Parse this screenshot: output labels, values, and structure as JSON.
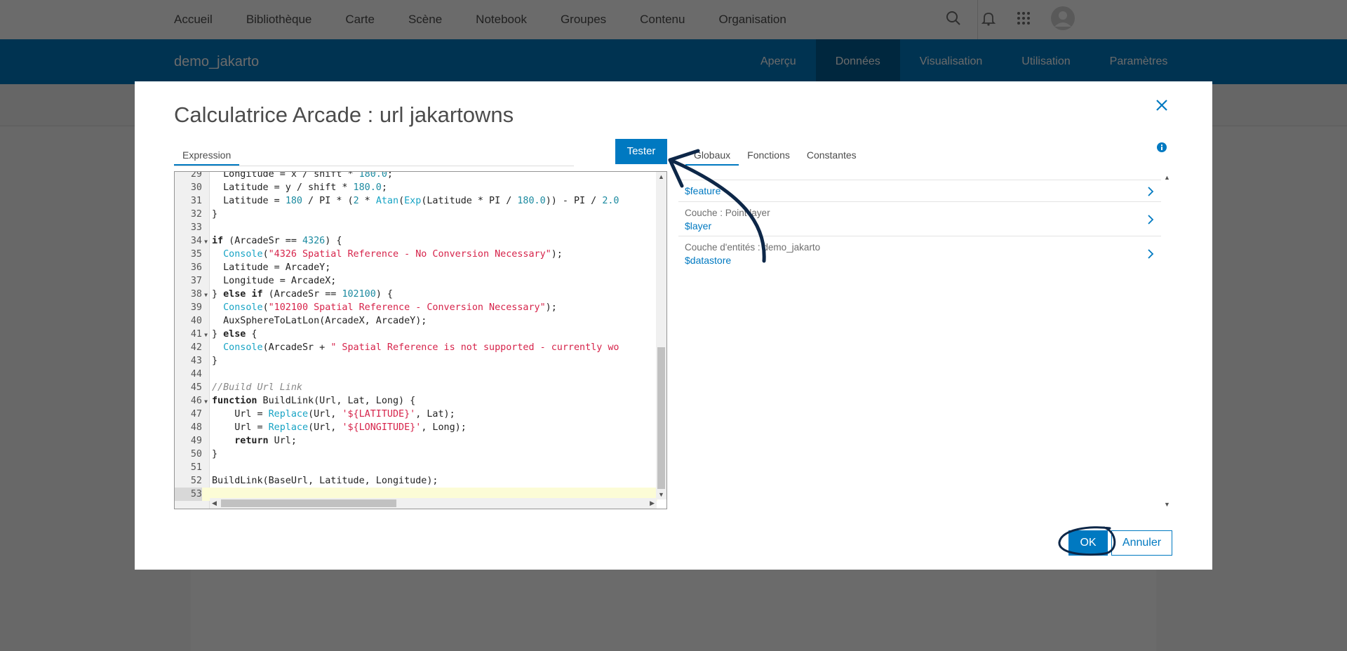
{
  "topnav": {
    "links": [
      "Accueil",
      "Bibliothèque",
      "Carte",
      "Scène",
      "Notebook",
      "Groupes",
      "Contenu",
      "Organisation"
    ],
    "icons": [
      "search-icon",
      "bell-icon",
      "apps-grid-icon",
      "avatar-icon"
    ]
  },
  "item": {
    "title": "demo_jakarto",
    "tabs": [
      "Aperçu",
      "Données",
      "Visualisation",
      "Utilisation",
      "Paramètres"
    ],
    "active_tab": "Données"
  },
  "modal": {
    "title": "Calculatrice Arcade : url jakartowns",
    "expression_tab": "Expression",
    "test_button": "Tester",
    "right_tabs": [
      "Globaux",
      "Fonctions",
      "Constantes"
    ],
    "active_right_tab": "Globaux",
    "globals": [
      {
        "label": "",
        "value": "$feature"
      },
      {
        "label": "Couche : Point layer",
        "value": "$layer"
      },
      {
        "label": "Couche d'entités : demo_jakarto",
        "value": "$datastore"
      }
    ],
    "ok_button": "OK",
    "cancel_button": "Annuler"
  },
  "editor": {
    "lines": [
      {
        "n": "29",
        "fold": false,
        "code": "  Longitude = x / shift * 180.0;"
      },
      {
        "n": "30",
        "fold": false,
        "code": "  Latitude = y / shift * 180.0;"
      },
      {
        "n": "31",
        "fold": false,
        "code": "  Latitude = 180 / PI * (2 * Atan(Exp(Latitude * PI / 180.0)) - PI / 2.0"
      },
      {
        "n": "32",
        "fold": false,
        "code": "}"
      },
      {
        "n": "33",
        "fold": false,
        "code": ""
      },
      {
        "n": "34",
        "fold": true,
        "code": "if (ArcadeSr == 4326) {"
      },
      {
        "n": "35",
        "fold": false,
        "code": "  Console(\"4326 Spatial Reference - No Conversion Necessary\");"
      },
      {
        "n": "36",
        "fold": false,
        "code": "  Latitude = ArcadeY;"
      },
      {
        "n": "37",
        "fold": false,
        "code": "  Longitude = ArcadeX;"
      },
      {
        "n": "38",
        "fold": true,
        "code": "} else if (ArcadeSr == 102100) {"
      },
      {
        "n": "39",
        "fold": false,
        "code": "  Console(\"102100 Spatial Reference - Conversion Necessary\");"
      },
      {
        "n": "40",
        "fold": false,
        "code": "  AuxSphereToLatLon(ArcadeX, ArcadeY);"
      },
      {
        "n": "41",
        "fold": true,
        "code": "} else {"
      },
      {
        "n": "42",
        "fold": false,
        "code": "  Console(ArcadeSr + \" Spatial Reference is not supported - currently wo"
      },
      {
        "n": "43",
        "fold": false,
        "code": "}"
      },
      {
        "n": "44",
        "fold": false,
        "code": ""
      },
      {
        "n": "45",
        "fold": false,
        "code": "//Build Url Link"
      },
      {
        "n": "46",
        "fold": true,
        "code": "function BuildLink(Url, Lat, Long) {"
      },
      {
        "n": "47",
        "fold": false,
        "code": "    Url = Replace(Url, '${LATITUDE}', Lat);"
      },
      {
        "n": "48",
        "fold": false,
        "code": "    Url = Replace(Url, '${LONGITUDE}', Long);"
      },
      {
        "n": "49",
        "fold": false,
        "code": "    return Url;"
      },
      {
        "n": "50",
        "fold": false,
        "code": "}"
      },
      {
        "n": "51",
        "fold": false,
        "code": ""
      },
      {
        "n": "52",
        "fold": false,
        "code": "BuildLink(BaseUrl, Latitude, Longitude);"
      },
      {
        "n": "53",
        "fold": false,
        "code": "",
        "active": true
      }
    ]
  },
  "colors": {
    "brand_blue": "#0079c1",
    "active_tab_bg": "#005e95",
    "annotation_navy": "#0d2748"
  }
}
